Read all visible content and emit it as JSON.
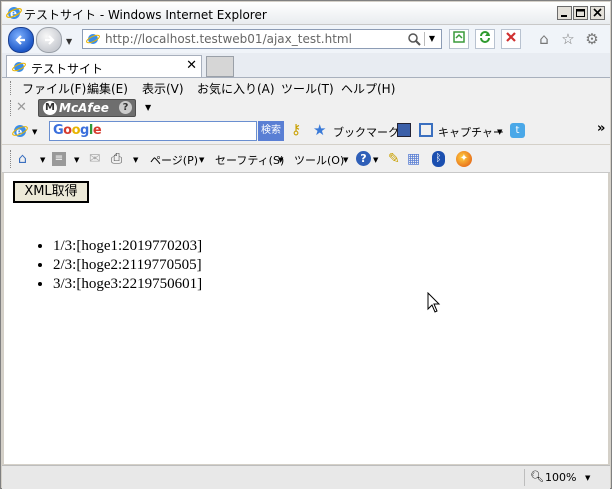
{
  "window": {
    "title": "テストサイト - Windows Internet Explorer"
  },
  "address_bar": {
    "url_host": "http://localhost.testweb01",
    "url_path": "/ajax_test.html"
  },
  "tab": {
    "label": "テストサイト"
  },
  "menu": {
    "items": [
      "ファイル(F)",
      "編集(E)",
      "表示(V)",
      "お気に入り(A)",
      "ツール(T)",
      "ヘルプ(H)"
    ]
  },
  "mcafee": {
    "label": "McAfee",
    "help": "?"
  },
  "google_bar": {
    "logo": "Google",
    "search_button": "検索",
    "bookmark_label": "ブックマーク",
    "capture_label": "キャプチャー"
  },
  "command_bar": {
    "page_label": "ページ(P)",
    "safety_label": "セーフティ(S)",
    "tools_label": "ツール(O)"
  },
  "content": {
    "button_label": "XML取得",
    "results": [
      "1/3:[hoge1:2019770203]",
      "2/3:[hoge2:2119770505]",
      "3/3:[hoge3:2219750601]"
    ]
  },
  "status_bar": {
    "zoom": "100%"
  }
}
